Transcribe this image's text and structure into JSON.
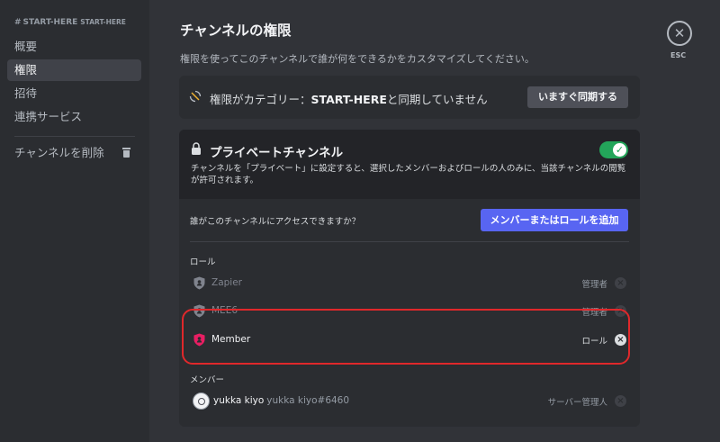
{
  "sidebar": {
    "header_channel": "START-HERE",
    "header_category": "START-HERE",
    "items": [
      {
        "label": "概要"
      },
      {
        "label": "権限"
      },
      {
        "label": "招待"
      },
      {
        "label": "連携サービス"
      }
    ],
    "delete_label": "チャンネルを削除"
  },
  "main": {
    "title": "チャンネルの権限",
    "description": "権限を使ってこのチャンネルで誰が何をできるかをカスタマイズしてください。",
    "esc_label": "ESC",
    "sync": {
      "text_prefix": "権限がカテゴリー：",
      "category": "START-HERE",
      "text_suffix": "と同期していません",
      "button": "いますぐ同期する"
    },
    "private": {
      "title": "プライベートチャンネル",
      "enabled": true,
      "description": "チャンネルを「プライベート」に設定すると、選択したメンバーおよびロールの人のみに、当該チャンネルの閲覧が許可されます。",
      "who_label": "誰がこのチャンネルにアクセスできますか？",
      "add_button": "メンバーまたはロールを追加",
      "roles_label": "ロール",
      "roles": [
        {
          "name": "Zapier",
          "type": "管理者"
        },
        {
          "name": "MEE6",
          "type": "管理者"
        },
        {
          "name": "Member",
          "type": "ロール"
        }
      ],
      "members_label": "メンバー",
      "members": [
        {
          "name": "yukka kiyo",
          "tag": "yukka kiyo#6460",
          "type": "サーバー管理人"
        }
      ]
    }
  },
  "colors": {
    "accent": "#5865f2",
    "toggle_on": "#23a55a",
    "highlight": "#e0282b",
    "member_role": "#e91e63"
  }
}
